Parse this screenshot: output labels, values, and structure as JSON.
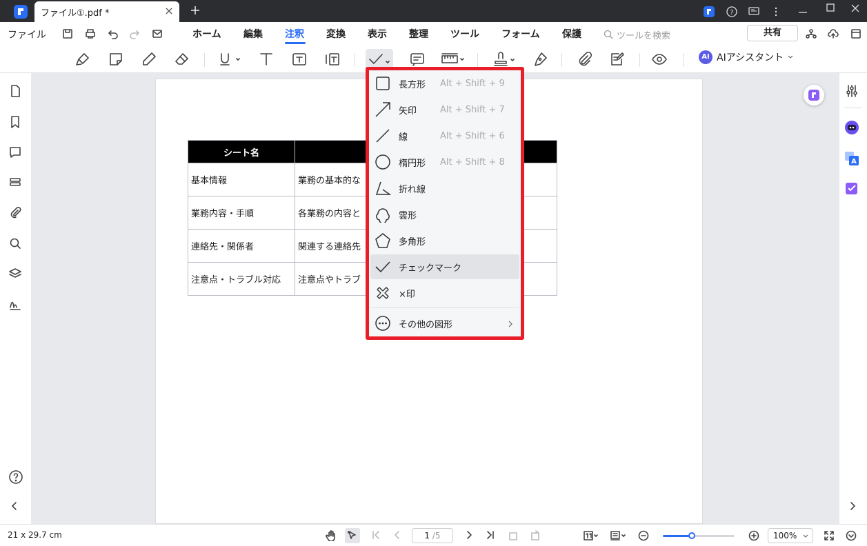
{
  "titlebar": {
    "tab_title": "ファイル①.pdf *"
  },
  "menubar": {
    "file": "ファイル",
    "tabs": [
      "ホーム",
      "編集",
      "注釈",
      "変換",
      "表示",
      "整理",
      "ツール",
      "フォーム",
      "保護"
    ],
    "active_tab": "注釈",
    "search_placeholder": "ツールを検索",
    "share": "共有"
  },
  "toolbar": {
    "ai_badge": "AI",
    "ai_label": "AIアシスタント"
  },
  "table": {
    "header": [
      "シート名",
      ""
    ],
    "rows": [
      [
        "基本情報",
        "業務の基本的な"
      ],
      [
        "業務内容・手順",
        "各業務の内容と"
      ],
      [
        "連絡先・関係者",
        "関連する連絡先"
      ],
      [
        "注意点・トラブル対応",
        "注意点やトラブ"
      ]
    ]
  },
  "dropdown": {
    "items": [
      {
        "label": "長方形",
        "shortcut": "Alt + Shift + 9",
        "icon": "rectangle-icon"
      },
      {
        "label": "矢印",
        "shortcut": "Alt + Shift + 7",
        "icon": "arrow-icon"
      },
      {
        "label": "線",
        "shortcut": "Alt + Shift + 6",
        "icon": "line-icon"
      },
      {
        "label": "楕円形",
        "shortcut": "Alt + Shift + 8",
        "icon": "ellipse-icon"
      },
      {
        "label": "折れ線",
        "shortcut": "",
        "icon": "polyline-icon"
      },
      {
        "label": "雲形",
        "shortcut": "",
        "icon": "cloud-icon"
      },
      {
        "label": "多角形",
        "shortcut": "",
        "icon": "polygon-icon"
      },
      {
        "label": "チェックマーク",
        "shortcut": "",
        "icon": "checkmark-icon"
      },
      {
        "label": "×印",
        "shortcut": "",
        "icon": "cross-icon"
      }
    ],
    "more": "その他の図形",
    "highlighted": "チェックマーク"
  },
  "statusbar": {
    "page_size": "21 x 29.7 cm",
    "current_page": "1",
    "total_pages": "/5",
    "zoom": "100%",
    "zoom_level": 0.4
  },
  "colors": {
    "accent": "#2a6df5",
    "highlight_border": "#e81e2a"
  }
}
